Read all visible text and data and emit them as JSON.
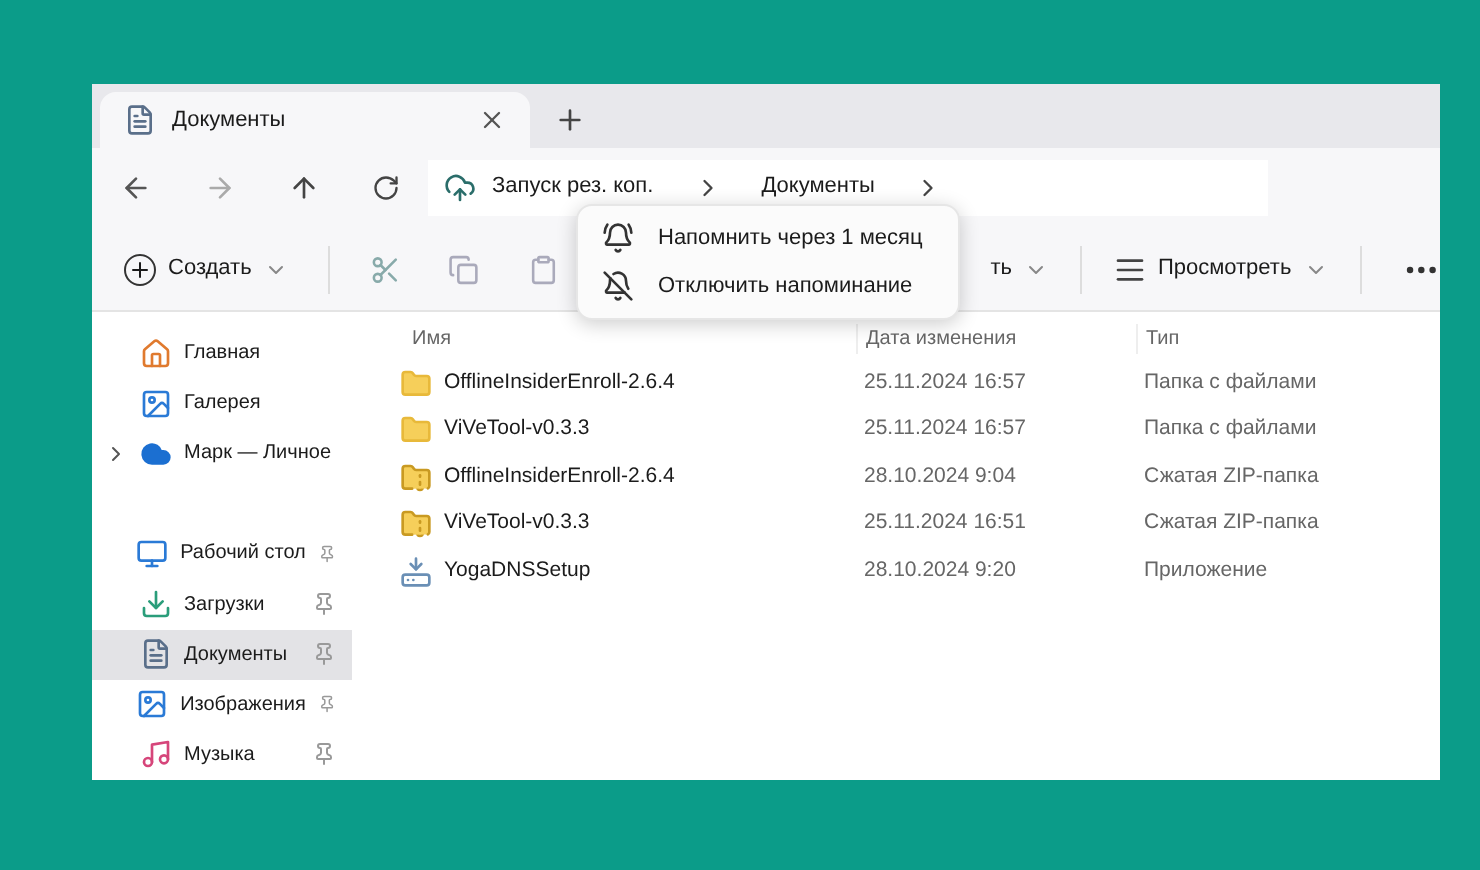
{
  "window": {
    "tab": {
      "title": "Документы",
      "selected": true
    }
  },
  "nav": {
    "breadcrumbs": [
      "Запуск рез. коп.",
      "Документы"
    ]
  },
  "backup_menu": {
    "items": [
      {
        "kind": "remind",
        "label": "Напомнить через 1 месяц"
      },
      {
        "kind": "disable",
        "label": "Отключить напоминание"
      }
    ]
  },
  "toolbar": {
    "create": "Создать",
    "sort_partial": "ть",
    "view": "Просмотреть"
  },
  "sidebar": {
    "items": [
      {
        "kind": "home",
        "label": "Главная",
        "selected": false
      },
      {
        "kind": "gallery",
        "label": "Галерея",
        "selected": false
      },
      {
        "kind": "cloud",
        "label": "Марк — Личное",
        "selected": false,
        "expandable": true
      },
      {
        "kind": "desktop",
        "label": "Рабочий стол",
        "selected": false,
        "pinned": true
      },
      {
        "kind": "downloads",
        "label": "Загрузки",
        "selected": false,
        "pinned": true
      },
      {
        "kind": "documents",
        "label": "Документы",
        "selected": true,
        "pinned": true
      },
      {
        "kind": "pictures",
        "label": "Изображения",
        "selected": false,
        "pinned": true
      },
      {
        "kind": "music",
        "label": "Музыка",
        "selected": false,
        "pinned": true
      }
    ]
  },
  "table": {
    "columns": [
      "Имя",
      "Дата изменения",
      "Тип"
    ],
    "rows": [
      {
        "kind": "folder",
        "name": "OfflineInsiderEnroll-2.6.4",
        "date": "25.11.2024 16:57",
        "type": "Папка с файлами"
      },
      {
        "kind": "folder",
        "name": "ViVeTool-v0.3.3",
        "date": "25.11.2024 16:57",
        "type": "Папка с файлами"
      },
      {
        "kind": "zip",
        "name": "OfflineInsiderEnroll-2.6.4",
        "date": "28.10.2024 9:04",
        "type": "Сжатая ZIP-папка"
      },
      {
        "kind": "zip",
        "name": "ViVeTool-v0.3.3",
        "date": "25.11.2024 16:51",
        "type": "Сжатая ZIP-папка"
      },
      {
        "kind": "app",
        "name": "YogaDNSSetup",
        "date": "28.10.2024 9:20",
        "type": "Приложение"
      }
    ]
  }
}
